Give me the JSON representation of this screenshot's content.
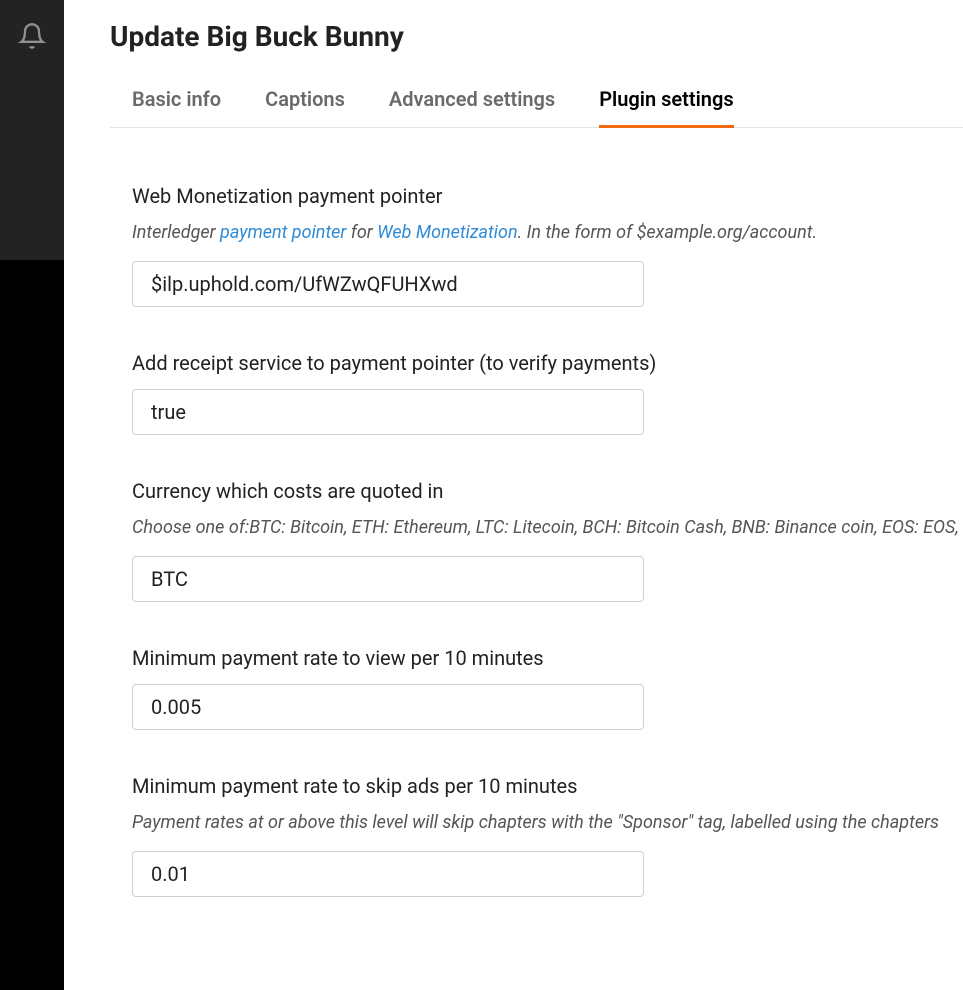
{
  "page": {
    "title": "Update Big Buck Bunny"
  },
  "tabs": [
    {
      "label": "Basic info",
      "active": false
    },
    {
      "label": "Captions",
      "active": false
    },
    {
      "label": "Advanced settings",
      "active": false
    },
    {
      "label": "Plugin settings",
      "active": true
    }
  ],
  "fields": {
    "payment_pointer": {
      "label": "Web Monetization payment pointer",
      "help_pre": "Interledger ",
      "help_link1": "payment pointer",
      "help_mid": " for ",
      "help_link2": "Web Monetization",
      "help_post": ". In the form of $example.org/account.",
      "value": "$ilp.uphold.com/UfWZwQFUHXwd"
    },
    "receipt_service": {
      "label": "Add receipt service to payment pointer (to verify payments)",
      "value": "true"
    },
    "currency": {
      "label": "Currency which costs are quoted in",
      "help": "Choose one of:BTC: Bitcoin, ETH: Ethereum, LTC: Litecoin, BCH: Bitcoin Cash, BNB: Binance coin, EOS: EOS, Bahraini dinar, BMD: Bermudan dollar, BRL: Brailian real, CAD: Canadian dollar, CHF: Swiss Franc, CLP: Ch",
      "value": "BTC"
    },
    "min_rate_view": {
      "label": "Minimum payment rate to view per 10 minutes",
      "value": "0.005"
    },
    "min_rate_skip": {
      "label": "Minimum payment rate to skip ads per 10 minutes",
      "help": "Payment rates at or above this level will skip chapters with the \"Sponsor\" tag, labelled using the chapters",
      "value": "0.01"
    }
  }
}
